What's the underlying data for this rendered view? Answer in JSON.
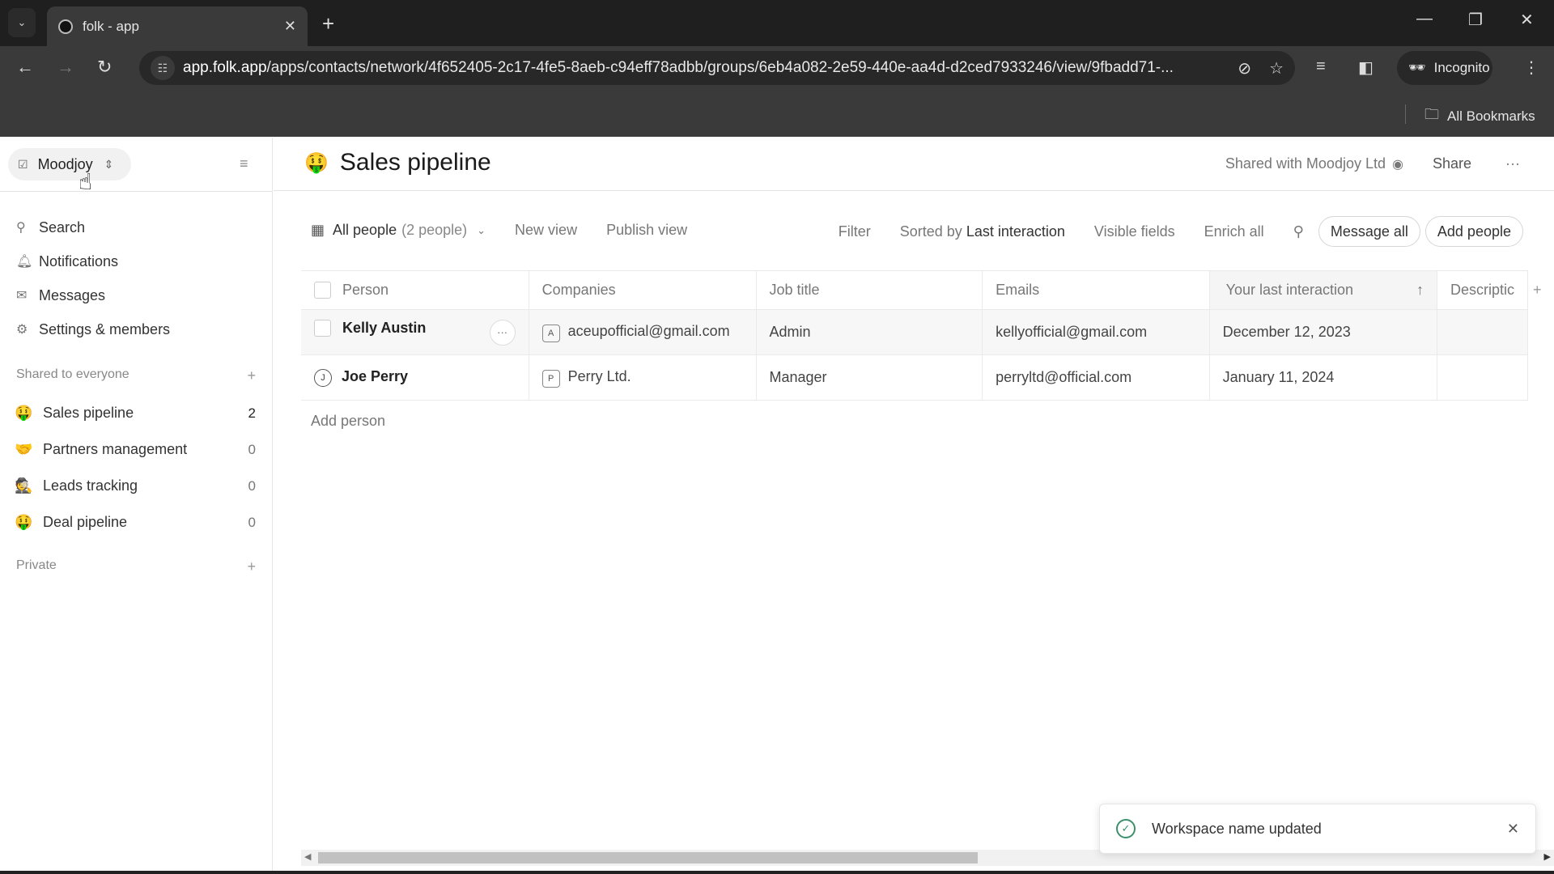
{
  "browser": {
    "tab_title": "folk - app",
    "url_host": "app.folk.app",
    "url_path": "/apps/contacts/network/4f652405-2c17-4fe5-8aeb-c94eff78adbb/groups/6eb4a082-2e59-440e-aa4d-d2ced7933246/view/9fbadd71-...",
    "incognito_label": "Incognito",
    "all_bookmarks_label": "All Bookmarks"
  },
  "sidebar": {
    "workspace_name": "Moodjoy",
    "nav": [
      {
        "icon": "search-icon",
        "glyph": "⚲",
        "label": "Search"
      },
      {
        "icon": "bell-icon",
        "glyph": "♫",
        "label": "Notifications"
      },
      {
        "icon": "mail-icon",
        "glyph": "✉",
        "label": "Messages"
      },
      {
        "icon": "gear-icon",
        "glyph": "⚙",
        "label": "Settings & members"
      }
    ],
    "shared_section_label": "Shared to everyone",
    "private_section_label": "Private",
    "groups": [
      {
        "emoji": "🤑",
        "label": "Sales pipeline",
        "count": "2"
      },
      {
        "emoji": "🤝",
        "label": "Partners management",
        "count": "0"
      },
      {
        "emoji": "🕵",
        "label": "Leads tracking",
        "count": "0"
      },
      {
        "emoji": "🤑",
        "label": "Deal pipeline",
        "count": "0"
      }
    ]
  },
  "header": {
    "emoji": "🤑",
    "title": "Sales pipeline",
    "shared_with": "Shared with Moodjoy Ltd",
    "share_label": "Share",
    "more_label": "···"
  },
  "viewbar": {
    "view_name": "All people",
    "view_count": "(2 people)",
    "new_view": "New view",
    "publish_view": "Publish view",
    "filter": "Filter",
    "sorted_by": "Sorted by",
    "sorted_value": "Last interaction",
    "visible_fields": "Visible fields",
    "enrich_all": "Enrich all",
    "message_all": "Message all",
    "add_people": "Add people"
  },
  "table": {
    "columns": [
      "Person",
      "Companies",
      "Job title",
      "Emails",
      "Your last interaction",
      "Descriptic"
    ],
    "rows": [
      {
        "person": "Kelly Austin",
        "company_badge": "A",
        "company": "aceupofficial@gmail.com",
        "job_title": "Admin",
        "email": "kellyofficial@gmail.com",
        "last_interaction": "December 12, 2023",
        "description": ""
      },
      {
        "person": "Joe Perry",
        "avatar": "J",
        "company_badge": "P",
        "company": "Perry Ltd.",
        "job_title": "Manager",
        "email": "perryltd@official.com",
        "last_interaction": "January 11, 2024",
        "description": ""
      }
    ],
    "add_person_label": "Add person"
  },
  "toast": {
    "message": "Workspace name updated"
  },
  "colors": {
    "success": "#3f8f6f"
  }
}
